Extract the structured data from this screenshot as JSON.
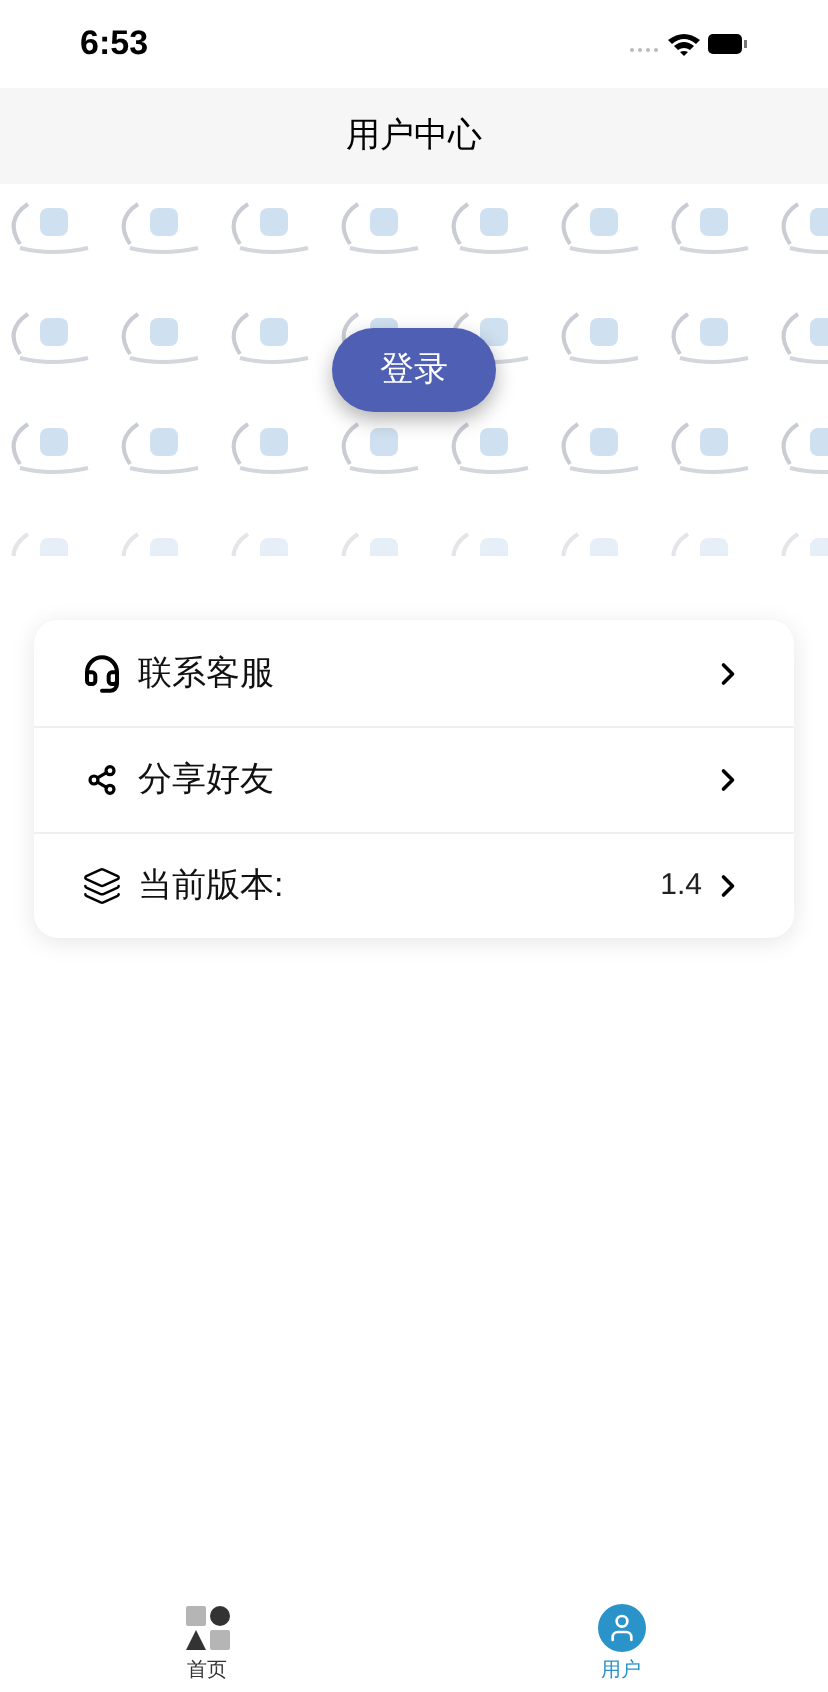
{
  "status_bar": {
    "time": "6:53"
  },
  "header": {
    "title": "用户中心"
  },
  "banner": {
    "kind": "picture",
    "login_button": "登录"
  },
  "menu": [
    {
      "kind": "support",
      "label": "联系客服"
    },
    {
      "kind": "share",
      "label": "分享好友"
    },
    {
      "kind": "version",
      "label": "当前版本:",
      "value": "1.4"
    }
  ],
  "tab_bar": [
    {
      "kind": "home",
      "label": "首页",
      "selected": false
    },
    {
      "kind": "user",
      "label": "用户",
      "selected": true
    }
  ]
}
